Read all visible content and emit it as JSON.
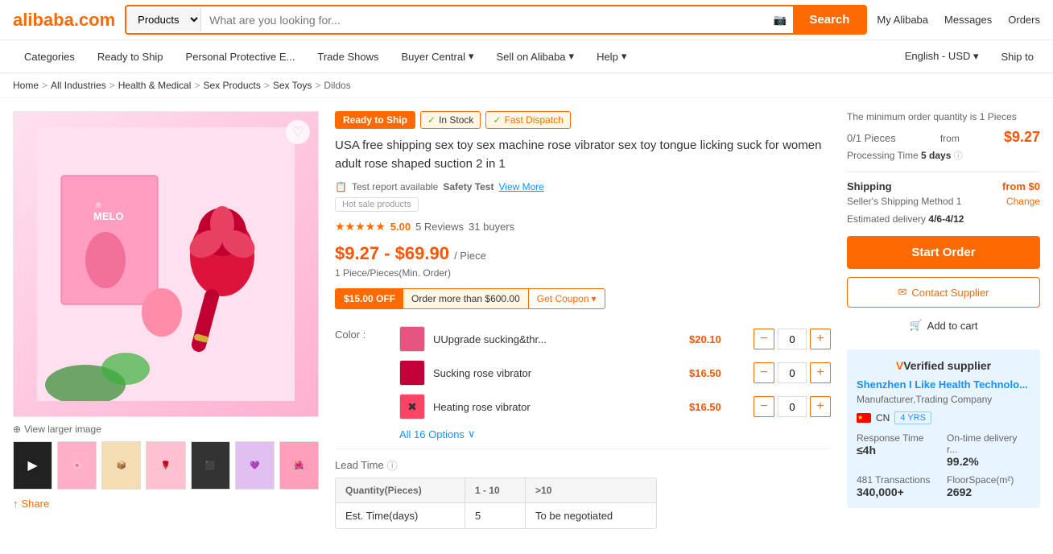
{
  "header": {
    "logo": "alibaba.com",
    "search_placeholder": "What are you looking for...",
    "products_select": "Products",
    "search_btn": "Search",
    "actions": [
      "My Alibaba",
      "Messages",
      "Orders"
    ]
  },
  "nav": {
    "items": [
      "Categories",
      "Ready to Ship",
      "Personal Protective E...",
      "Trade Shows",
      "Buyer Central",
      "Sell on Alibaba",
      "Help"
    ],
    "right_items": [
      "English - USD",
      "Ship to"
    ]
  },
  "breadcrumb": {
    "items": [
      "Home",
      "All Industries",
      "Health & Medical",
      "Sex Products",
      "Sex Toys",
      "Dildos"
    ]
  },
  "product": {
    "badges": {
      "ready": "Ready to Ship",
      "instock": "In Stock",
      "dispatch": "Fast Dispatch"
    },
    "title": "USA free shipping sex toy sex machine rose vibrator sex toy tongue licking suck for women adult rose shaped suction 2 in 1",
    "safety_test": "Test report available",
    "safety_test_label": "Safety Test",
    "safety_test_link": "View More",
    "hot_sale": "Hot sale products",
    "rating": {
      "score": "5.00",
      "reviews": "5 Reviews",
      "buyers": "31 buyers"
    },
    "price_low": "$9.27",
    "price_high": "$69.90",
    "price_unit": "/ Piece",
    "min_order": "1 Piece/Pieces(Min. Order)",
    "coupon": {
      "off": "$15.00 OFF",
      "condition": "Order more than $600.00",
      "btn": "Get Coupon"
    },
    "colors": [
      {
        "name": "UUpgrade sucking&thr...",
        "price": "$20.10",
        "qty": "0",
        "bg": "#e75480"
      },
      {
        "name": "Sucking rose vibrator",
        "price": "$16.50",
        "qty": "0",
        "bg": "#c2003a"
      },
      {
        "name": "Heating rose vibrator",
        "price": "$16.50",
        "qty": "0",
        "bg": "#cc0033"
      }
    ],
    "all_options": "All 16 Options",
    "lead_time_label": "Lead Time",
    "lead_table": {
      "headers": [
        "Quantity(Pieces)",
        "1 - 10",
        ">10"
      ],
      "rows": [
        [
          "Est. Time(days)",
          "5",
          "To be negotiated"
        ]
      ]
    }
  },
  "order_panel": {
    "min_qty_text": "The minimum order quantity is 1 Pieces",
    "qty_spec": "0/1 Pieces",
    "qty_from": "from",
    "qty_price": "$9.27",
    "processing_label": "Processing Time",
    "processing_value": "5 days",
    "shipping_label": "Shipping",
    "shipping_price": "from $0",
    "shipping_method": "Seller's Shipping Method 1",
    "shipping_change": "Change",
    "delivery_label": "Estimated delivery",
    "delivery_value": "4/6-4/12",
    "start_order_btn": "Start Order",
    "contact_supplier_btn": "Contact Supplier",
    "add_to_cart_btn": "Add to cart"
  },
  "supplier": {
    "verified_title": "Verified supplier",
    "name": "Shenzhen I Like Health Technolo...",
    "type": "Manufacturer,Trading Company",
    "country": "CN",
    "years": "4 YRS",
    "stats": [
      {
        "label": "Response Time",
        "value": "≤4h"
      },
      {
        "label": "On-time delivery r...",
        "value": "99.2%"
      },
      {
        "label": "481 Transactions",
        "value": "340,000+",
        "note": ""
      },
      {
        "label": "FloorSpace(m²)",
        "value": "2692"
      }
    ]
  },
  "thumbnails": [
    "🎥",
    "🌸",
    "📦",
    "🌹",
    "⬛",
    "💜",
    "🌺"
  ],
  "share_label": "Share"
}
